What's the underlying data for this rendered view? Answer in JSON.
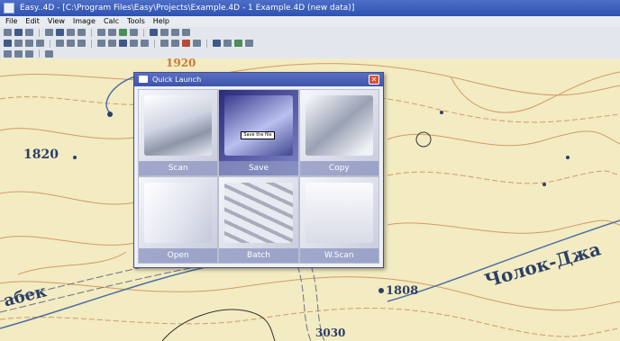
{
  "window": {
    "title": "Easy..4D - [C:\\Program Files\\Easy\\Projects\\Example.4D - 1 Example.4D (new data)]"
  },
  "menubar": {
    "items": [
      "File",
      "Edit",
      "View",
      "Image",
      "Calc",
      "Tools",
      "Help"
    ]
  },
  "map": {
    "labels": {
      "elev_1820": "1820",
      "elev_1808": "1808",
      "elev_top": "1920",
      "elev_bottom": "3030",
      "river_left": "абек",
      "river_right": "Чолок-Джа"
    },
    "colors": {
      "paper": "#f3ebc2",
      "contour": "#d49a63",
      "water": "#4c6fa3",
      "road": "#6f6f88"
    }
  },
  "dialog": {
    "title": "Quick Launch",
    "close_glyph": "✕",
    "tooltip": "Save the file",
    "tiles": [
      {
        "label": "Scan"
      },
      {
        "label": "Save"
      },
      {
        "label": "Copy"
      },
      {
        "label": "Open"
      },
      {
        "label": "Batch"
      },
      {
        "label": "W.Scan"
      }
    ]
  }
}
